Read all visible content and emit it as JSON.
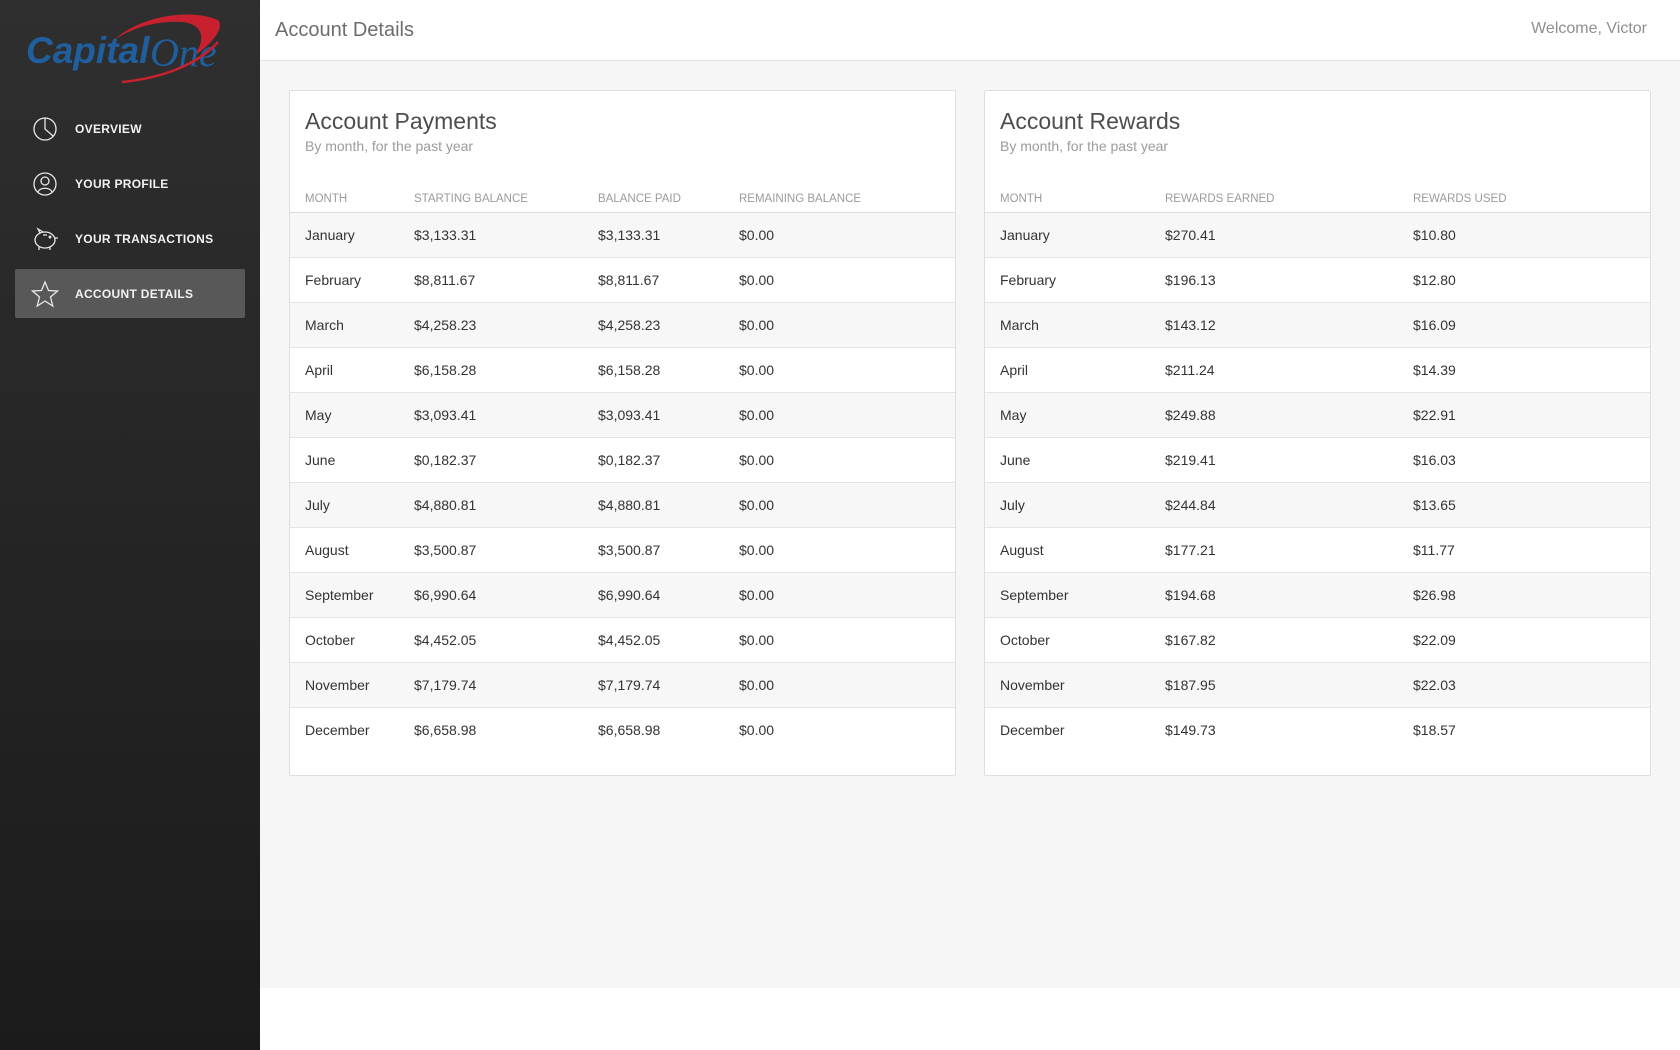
{
  "brand": {
    "logo_text": "CapitalOne",
    "colors": {
      "blue": "#1f5f9e",
      "red": "#c8202f"
    }
  },
  "sidebar": {
    "items": [
      {
        "label": "OVERVIEW",
        "icon": "pie-chart-icon",
        "active": false
      },
      {
        "label": "YOUR PROFILE",
        "icon": "user-icon",
        "active": false
      },
      {
        "label": "YOUR TRANSACTIONS",
        "icon": "piggy-bank-icon",
        "active": false
      },
      {
        "label": "ACCOUNT DETAILS",
        "icon": "star-icon",
        "active": true
      }
    ]
  },
  "header": {
    "title": "Account Details",
    "welcome": "Welcome, Victor"
  },
  "payments": {
    "title": "Account Payments",
    "subtitle": "By month, for the past year",
    "columns": [
      "MONTH",
      "STARTING BALANCE",
      "BALANCE PAID",
      "REMAINING BALANCE"
    ],
    "rows": [
      [
        "January",
        "$3,133.31",
        "$3,133.31",
        "$0.00"
      ],
      [
        "February",
        "$8,811.67",
        "$8,811.67",
        "$0.00"
      ],
      [
        "March",
        "$4,258.23",
        "$4,258.23",
        "$0.00"
      ],
      [
        "April",
        "$6,158.28",
        "$6,158.28",
        "$0.00"
      ],
      [
        "May",
        "$3,093.41",
        "$3,093.41",
        "$0.00"
      ],
      [
        "June",
        "$0,182.37",
        "$0,182.37",
        "$0.00"
      ],
      [
        "July",
        "$4,880.81",
        "$4,880.81",
        "$0.00"
      ],
      [
        "August",
        "$3,500.87",
        "$3,500.87",
        "$0.00"
      ],
      [
        "September",
        "$6,990.64",
        "$6,990.64",
        "$0.00"
      ],
      [
        "October",
        "$4,452.05",
        "$4,452.05",
        "$0.00"
      ],
      [
        "November",
        "$7,179.74",
        "$7,179.74",
        "$0.00"
      ],
      [
        "December",
        "$6,658.98",
        "$6,658.98",
        "$0.00"
      ]
    ]
  },
  "rewards": {
    "title": "Account Rewards",
    "subtitle": "By month, for the past year",
    "columns": [
      "MONTH",
      "REWARDS EARNED",
      "REWARDS USED"
    ],
    "rows": [
      [
        "January",
        "$270.41",
        "$10.80"
      ],
      [
        "February",
        "$196.13",
        "$12.80"
      ],
      [
        "March",
        "$143.12",
        "$16.09"
      ],
      [
        "April",
        "$211.24",
        "$14.39"
      ],
      [
        "May",
        "$249.88",
        "$22.91"
      ],
      [
        "June",
        "$219.41",
        "$16.03"
      ],
      [
        "July",
        "$244.84",
        "$13.65"
      ],
      [
        "August",
        "$177.21",
        "$11.77"
      ],
      [
        "September",
        "$194.68",
        "$26.98"
      ],
      [
        "October",
        "$167.82",
        "$22.09"
      ],
      [
        "November",
        "$187.95",
        "$22.03"
      ],
      [
        "December",
        "$149.73",
        "$18.57"
      ]
    ]
  }
}
